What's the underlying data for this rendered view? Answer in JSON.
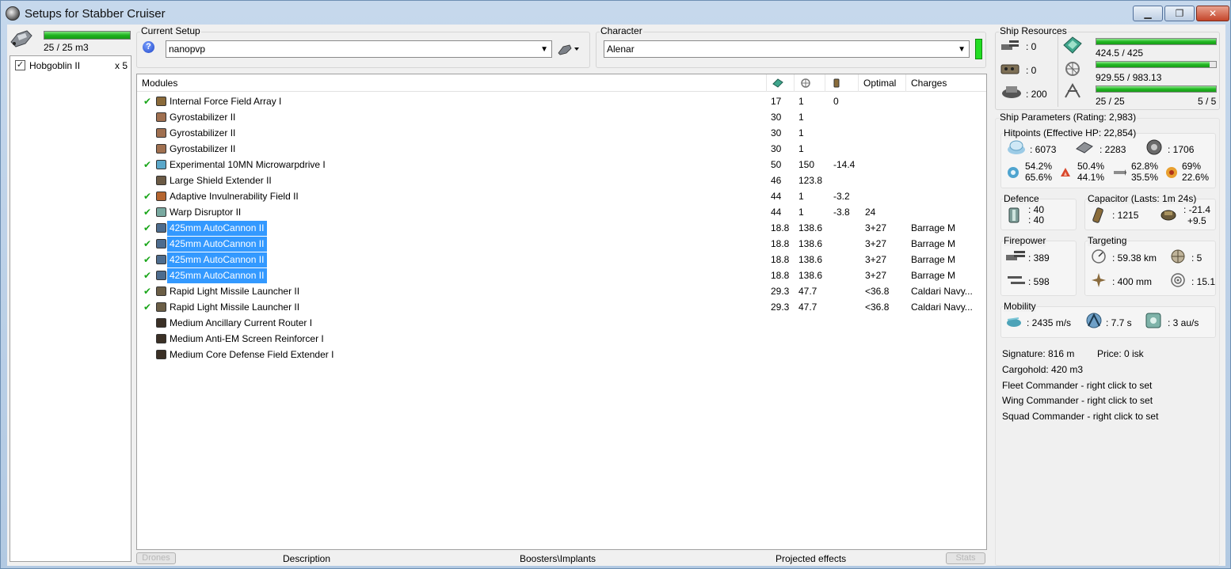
{
  "window": {
    "title": "Setups for Stabber Cruiser",
    "min_label": "▁",
    "max_label": "❐",
    "close_label": "✕"
  },
  "drone_bay": {
    "capacity_text": "25 / 25 m3",
    "capacity_fraction": 1.0,
    "items": [
      {
        "checked": true,
        "name": "Hobgoblin II",
        "count": "x 5"
      }
    ]
  },
  "setup": {
    "label": "Current Setup",
    "value": "nanopvp"
  },
  "character": {
    "label": "Character",
    "value": "Alenar"
  },
  "modules": {
    "headers": {
      "name": "Modules",
      "optimal": "Optimal",
      "charges": "Charges"
    },
    "header_icons": [
      "cpu-icon",
      "powergrid-icon",
      "capacitor-icon"
    ],
    "rows": [
      {
        "active": true,
        "icon": "damage-control-icon",
        "name": "Internal Force Field Array I",
        "cpu": "17",
        "pg": "1",
        "cap": "0",
        "optimal": "",
        "charges": "",
        "selected": false
      },
      {
        "active": false,
        "icon": "gyrostabilizer-icon",
        "name": "Gyrostabilizer II",
        "cpu": "30",
        "pg": "1",
        "cap": "",
        "optimal": "",
        "charges": "",
        "selected": false
      },
      {
        "active": false,
        "icon": "gyrostabilizer-icon",
        "name": "Gyrostabilizer II",
        "cpu": "30",
        "pg": "1",
        "cap": "",
        "optimal": "",
        "charges": "",
        "selected": false
      },
      {
        "active": false,
        "icon": "gyrostabilizer-icon",
        "name": "Gyrostabilizer II",
        "cpu": "30",
        "pg": "1",
        "cap": "",
        "optimal": "",
        "charges": "",
        "selected": false
      },
      {
        "active": true,
        "icon": "microwarpdrive-icon",
        "name": "Experimental 10MN Microwarpdrive I",
        "cpu": "50",
        "pg": "150",
        "cap": "-14.4",
        "optimal": "",
        "charges": "",
        "selected": false
      },
      {
        "active": false,
        "icon": "shield-extender-icon",
        "name": "Large Shield Extender II",
        "cpu": "46",
        "pg": "123.8",
        "cap": "",
        "optimal": "",
        "charges": "",
        "selected": false
      },
      {
        "active": true,
        "icon": "invuln-field-icon",
        "name": "Adaptive Invulnerability Field II",
        "cpu": "44",
        "pg": "1",
        "cap": "-3.2",
        "optimal": "",
        "charges": "",
        "selected": false
      },
      {
        "active": true,
        "icon": "warp-disruptor-icon",
        "name": "Warp Disruptor II",
        "cpu": "44",
        "pg": "1",
        "cap": "-3.8",
        "optimal": "24",
        "charges": "",
        "selected": false
      },
      {
        "active": true,
        "icon": "autocannon-icon",
        "name": "425mm AutoCannon II",
        "cpu": "18.8",
        "pg": "138.6",
        "cap": "",
        "optimal": "3+27",
        "charges": "Barrage M",
        "selected": true
      },
      {
        "active": true,
        "icon": "autocannon-icon",
        "name": "425mm AutoCannon II",
        "cpu": "18.8",
        "pg": "138.6",
        "cap": "",
        "optimal": "3+27",
        "charges": "Barrage M",
        "selected": true
      },
      {
        "active": true,
        "icon": "autocannon-icon",
        "name": "425mm AutoCannon II",
        "cpu": "18.8",
        "pg": "138.6",
        "cap": "",
        "optimal": "3+27",
        "charges": "Barrage M",
        "selected": true
      },
      {
        "active": true,
        "icon": "autocannon-icon",
        "name": "425mm AutoCannon II",
        "cpu": "18.8",
        "pg": "138.6",
        "cap": "",
        "optimal": "3+27",
        "charges": "Barrage M",
        "selected": true
      },
      {
        "active": true,
        "icon": "missile-launcher-icon",
        "name": "Rapid Light Missile Launcher II",
        "cpu": "29.3",
        "pg": "47.7",
        "cap": "",
        "optimal": "<36.8",
        "charges": "Caldari Navy...",
        "selected": false
      },
      {
        "active": true,
        "icon": "missile-launcher-icon",
        "name": "Rapid Light Missile Launcher II",
        "cpu": "29.3",
        "pg": "47.7",
        "cap": "",
        "optimal": "<36.8",
        "charges": "Caldari Navy...",
        "selected": false
      },
      {
        "active": false,
        "icon": "rig-icon",
        "name": "Medium Ancillary Current Router I",
        "cpu": "",
        "pg": "",
        "cap": "",
        "optimal": "",
        "charges": "",
        "selected": false
      },
      {
        "active": false,
        "icon": "rig-icon",
        "name": "Medium Anti-EM Screen Reinforcer I",
        "cpu": "",
        "pg": "",
        "cap": "",
        "optimal": "",
        "charges": "",
        "selected": false
      },
      {
        "active": false,
        "icon": "rig-icon",
        "name": "Medium Core Defense Field Extender I",
        "cpu": "",
        "pg": "",
        "cap": "",
        "optimal": "",
        "charges": "",
        "selected": false
      }
    ]
  },
  "tabs": {
    "drones": "Drones",
    "description": "Description",
    "boosters": "Boosters\\Implants",
    "projected": "Projected effects",
    "stats": "Stats"
  },
  "resources": {
    "label": "Ship Resources",
    "turret_hardpoints": ": 0",
    "launcher_hardpoints": ": 0",
    "calibration": ": 200",
    "cpu_text": "424.5 / 425",
    "cpu_fraction": 0.9988,
    "pg_text": "929.55 / 983.13",
    "pg_fraction": 0.9455,
    "drone_bw_text": "25 / 25",
    "drone_count_text": "5 / 5",
    "drone_fraction": 1.0
  },
  "parameters": {
    "label": "Ship Parameters (Rating: 2,983)",
    "hitpoints_label": "Hitpoints (Effective HP: 22,854)",
    "shield_hp": ": 6073",
    "armor_hp": ": 2283",
    "structure_hp": ": 1706",
    "res_em_top": "54.2%",
    "res_em_bottom": "65.6%",
    "res_therm_top": "50.4%",
    "res_therm_bottom": "44.1%",
    "res_kin_top": "62.8%",
    "res_kin_bottom": "35.5%",
    "res_exp_top": "69%",
    "res_exp_bottom": "22.6%",
    "defence_label": "Defence",
    "defence_top": ": 40",
    "defence_bottom": ": 40",
    "capacitor_label": "Capacitor (Lasts: 1m 24s)",
    "capacitor_amount": ": 1215",
    "capacitor_delta_top": ": -21.4",
    "capacitor_delta_bottom": "+9.5",
    "firepower_label": "Firepower",
    "firepower_top": ": 389",
    "firepower_bottom": ": 598",
    "targeting_label": "Targeting",
    "target_range": ": 59.38 km",
    "max_targets": ": 5",
    "scan_res": ": 400 mm",
    "sensor_strength": ": 15.1",
    "mobility_label": "Mobility",
    "speed": ": 2435 m/s",
    "align_time": ": 7.7 s",
    "warp_speed": ": 3 au/s",
    "signature": "Signature: 816 m",
    "price": "Price: 0 isk",
    "cargohold": "Cargohold: 420 m3",
    "fleet_commander": "Fleet Commander - right click to set",
    "wing_commander": "Wing Commander - right click to set",
    "squad_commander": "Squad Commander - right click to set"
  },
  "colors": {
    "accent_green": "#22b822",
    "selection_blue": "#3399ff",
    "check_green": "#1aa61a"
  }
}
